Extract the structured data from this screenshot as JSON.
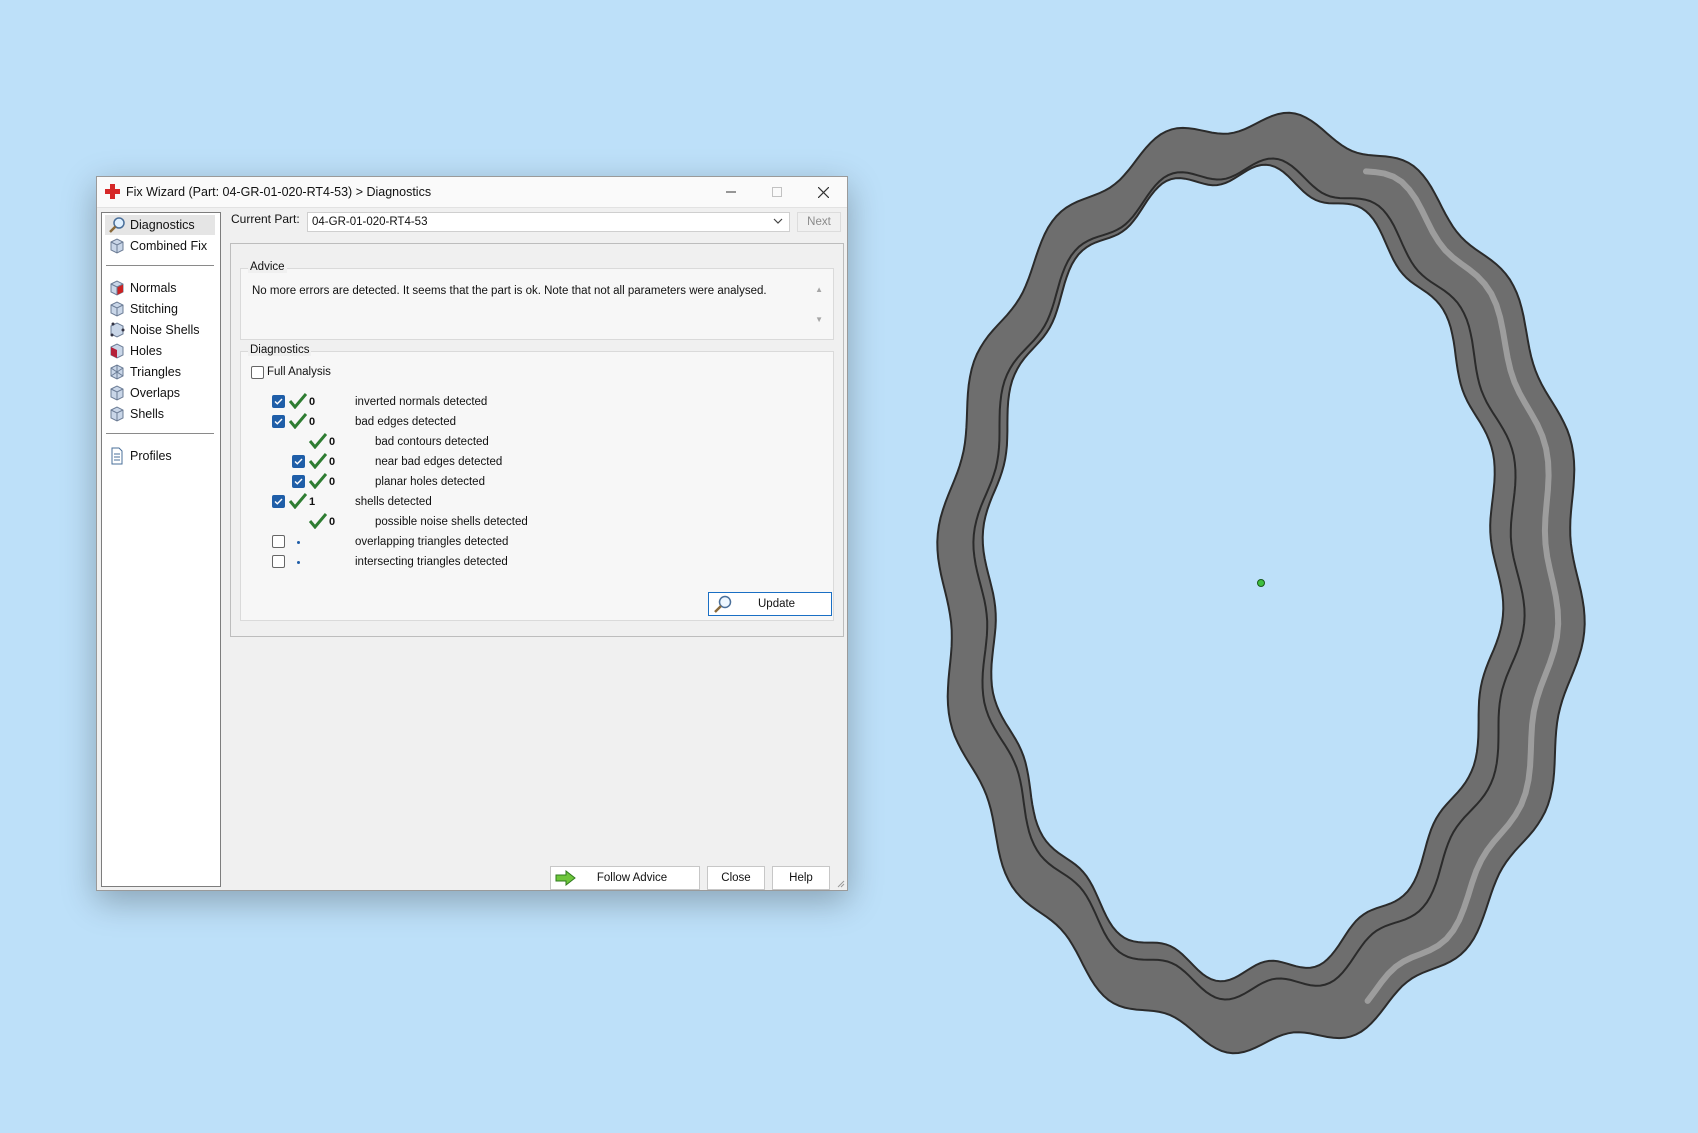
{
  "window": {
    "title": "Fix Wizard (Part: 04-GR-01-020-RT4-53) > Diagnostics"
  },
  "sidebar": {
    "items": [
      {
        "label": "Diagnostics",
        "icon": "magnifier-icon",
        "selected": true
      },
      {
        "label": "Combined Fix",
        "icon": "cube-icon"
      },
      {
        "label": "Normals",
        "icon": "cube-icon"
      },
      {
        "label": "Stitching",
        "icon": "cube-icon"
      },
      {
        "label": "Noise Shells",
        "icon": "cube-icon"
      },
      {
        "label": "Holes",
        "icon": "cube-icon"
      },
      {
        "label": "Triangles",
        "icon": "cube-icon"
      },
      {
        "label": "Overlaps",
        "icon": "cube-icon"
      },
      {
        "label": "Shells",
        "icon": "cube-icon"
      },
      {
        "label": "Profiles",
        "icon": "document-icon"
      }
    ]
  },
  "current_part": {
    "label": "Current Part:",
    "value": "04-GR-01-020-RT4-53",
    "next_label": "Next"
  },
  "advice": {
    "heading": "Advice",
    "text": "No more errors are detected. It seems that the part is ok. Note that not all parameters were analysed."
  },
  "diagnostics": {
    "heading": "Diagnostics",
    "full_analysis_label": "Full Analysis",
    "full_analysis_checked": false,
    "rows": [
      {
        "checkbox": "checked",
        "status": "ok",
        "count": "0",
        "label": "inverted normals detected"
      },
      {
        "checkbox": "checked",
        "status": "ok",
        "count": "0",
        "label": "bad edges detected"
      },
      {
        "checkbox": "none",
        "status": "ok",
        "count": "0",
        "label": "bad contours detected"
      },
      {
        "checkbox": "checked",
        "status": "ok",
        "count": "0",
        "label": "near bad edges detected"
      },
      {
        "checkbox": "checked",
        "status": "ok",
        "count": "0",
        "label": "planar holes detected"
      },
      {
        "checkbox": "checked",
        "status": "ok",
        "count": "1",
        "label": "shells detected"
      },
      {
        "checkbox": "none",
        "status": "ok",
        "count": "0",
        "label": "possible noise shells detected"
      },
      {
        "checkbox": "unchecked",
        "status": "not-run",
        "count": "",
        "label": "overlapping triangles detected"
      },
      {
        "checkbox": "unchecked",
        "status": "not-run",
        "count": "",
        "label": "intersecting triangles detected"
      }
    ],
    "update_label": "Update"
  },
  "footer": {
    "follow_advice_label": "Follow Advice",
    "close_label": "Close",
    "help_label": "Help"
  },
  "colors": {
    "background": "#bde0f9",
    "ok_check": "#2e7d32",
    "checkbox_checked": "#1f5ea8",
    "ring_body": "#6f6f6f"
  }
}
